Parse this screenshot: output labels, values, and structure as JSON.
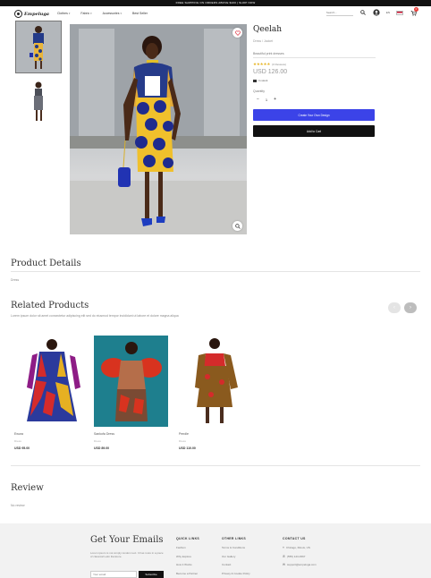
{
  "announcement": "FREE SHIPPING ON ORDERS ABOVE $100 | SHOP NOW",
  "header": {
    "logo_text": "Empeluga",
    "nav": [
      "Clothes",
      "Fabric",
      "Accessories",
      "Best Seller"
    ],
    "search_placeholder": "Search...",
    "language": "EN",
    "cart_count": "0"
  },
  "product": {
    "title": "Qeelah",
    "subtitle": "Dress / Jacket",
    "short_desc": "Beautiful print dresses",
    "stars": "★★★★★",
    "reviews": "(0 Reviews)",
    "price": "USD 126.00",
    "stock": "In stock",
    "quantity_label": "Quantity",
    "quantity": "1",
    "qty_minus": "−",
    "qty_plus": "+",
    "customize_label": "Create Your Own Design",
    "add_to_cart_label": "Add to Cart"
  },
  "details": {
    "title": "Product Details",
    "text": "Dress"
  },
  "related": {
    "title": "Related Products",
    "description": "Lorem ipsum dolor sit amet consectetur adipiscing elit sed do eiusmod tempor incididunt ut labore et dolore magna aliqua",
    "prev": "‹",
    "next": "›",
    "items": [
      {
        "name": "Ewura",
        "category": "Dress",
        "price": "USD 95.00"
      },
      {
        "name": "Sankofa Dress",
        "category": "Dress",
        "price": "USD 89.00"
      },
      {
        "name": "Pendle",
        "category": "Dress",
        "price": "USD 110.00"
      }
    ]
  },
  "review": {
    "title": "Review",
    "text": "No review"
  },
  "footer": {
    "title": "Get Your Emails",
    "text": "Lorem ipsum is not simply random text. It has roots in a piece of classical Latin literature.",
    "email_placeholder": "Your email",
    "subscribe_label": "Subscribe",
    "quick_links": {
      "title": "QUICK LINKS",
      "items": [
        "Fashion",
        "Why Explore",
        "How it Works",
        "Become a Partner"
      ]
    },
    "other_links": {
      "title": "OTHER LINKS",
      "items": [
        "Terms & Conditions",
        "Our Gallery",
        "Contact",
        "Privacy & Cookie Policy"
      ]
    },
    "contact": {
      "title": "CONTACT US",
      "items": [
        "Chicago, Illinois, US",
        "(555) 123-4567",
        "support@empeluga.com"
      ]
    }
  }
}
